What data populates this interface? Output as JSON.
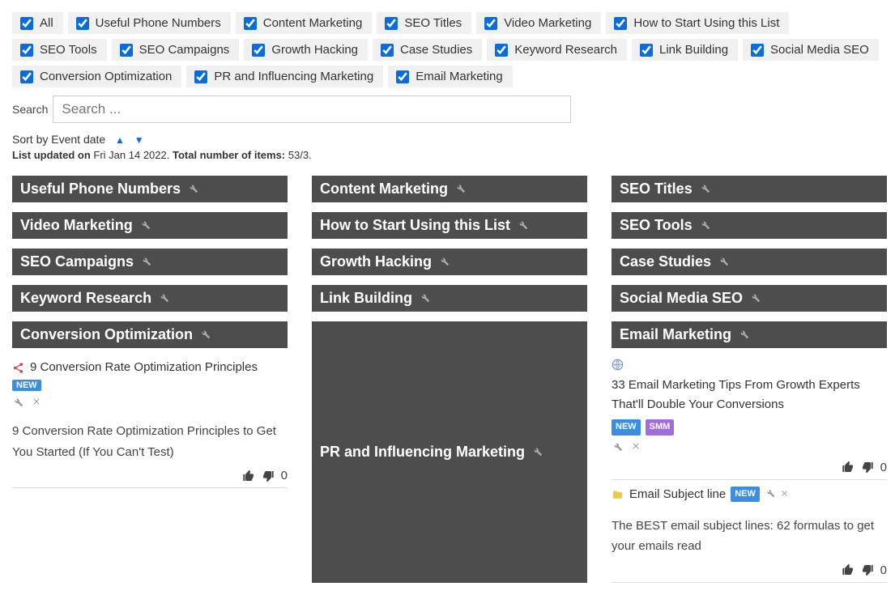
{
  "filters": [
    "All",
    "Useful Phone Numbers",
    "Content Marketing",
    "SEO Titles",
    "Video Marketing",
    "How to Start Using this List",
    "SEO Tools",
    "SEO Campaigns",
    "Growth Hacking",
    "Case Studies",
    "Keyword Research",
    "Link Building",
    "Social Media SEO",
    "Conversion Optimization",
    "PR and Influencing Marketing",
    "Email Marketing"
  ],
  "search": {
    "label": "Search",
    "placeholder": "Search ..."
  },
  "sort": {
    "prefix": "Sort by",
    "field": "Event date"
  },
  "meta": {
    "updated_label": "List updated on",
    "updated_date": "Fri Jan 14 2022",
    "total_label": "Total number of items:",
    "total_value": "53/3."
  },
  "categories": {
    "useful_phone": "Useful Phone Numbers",
    "content_marketing": "Content Marketing",
    "seo_titles": "SEO Titles",
    "video_marketing": "Video Marketing",
    "how_to_start": "How to Start Using this List",
    "seo_tools": "SEO Tools",
    "seo_campaigns": "SEO Campaigns",
    "growth_hacking": "Growth Hacking",
    "case_studies": "Case Studies",
    "keyword_research": "Keyword Research",
    "link_building": "Link Building",
    "social_media_seo": "Social Media SEO",
    "conversion_opt": "Conversion Optimization",
    "pr_influencing": "PR and Influencing Marketing",
    "email_marketing": "Email Marketing"
  },
  "items": {
    "conv1": {
      "title": "9 Conversion Rate Optimization Principles",
      "badges": [
        "NEW"
      ],
      "desc": "9 Conversion Rate Optimization Principles to Get You Started (If You Can't Test)",
      "votes": "0"
    },
    "email1": {
      "title": "33 Email Marketing Tips From Growth Experts That'll Double Your Conversions",
      "badges": [
        "NEW",
        "SMM"
      ],
      "votes": "0"
    },
    "email2": {
      "title": "Email Subject line",
      "badges": [
        "NEW"
      ],
      "desc": "The BEST email subject lines: 62 formulas to get your emails read",
      "votes": "0"
    }
  }
}
